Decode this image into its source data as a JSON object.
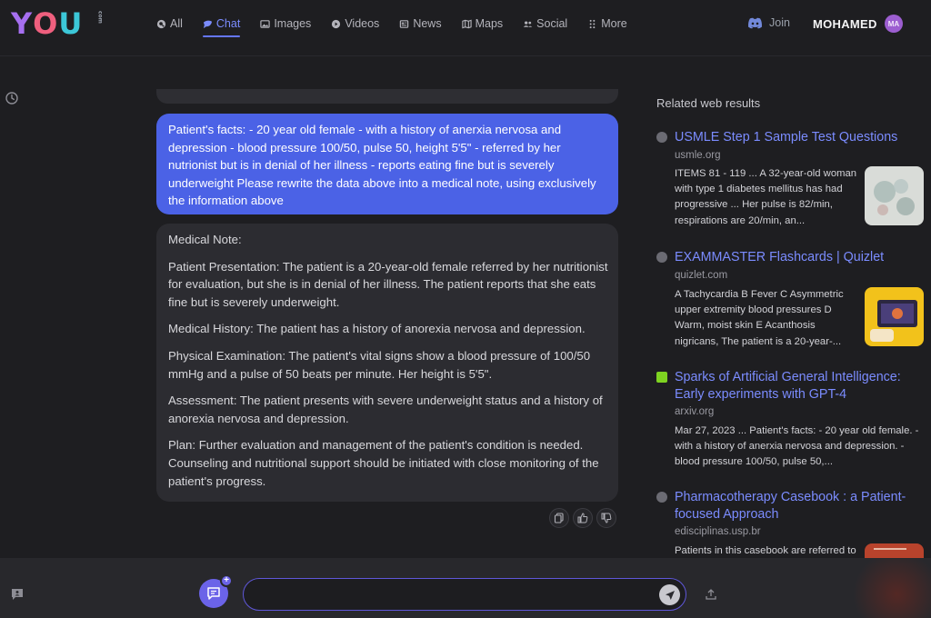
{
  "header": {
    "logo_letters": [
      "Y",
      "O",
      "U"
    ],
    "logo_suffix": "com",
    "tabs": [
      {
        "label": "All",
        "icon": "search-icon"
      },
      {
        "label": "Chat",
        "icon": "chat-icon",
        "active": true
      },
      {
        "label": "Images",
        "icon": "images-icon"
      },
      {
        "label": "Videos",
        "icon": "play-icon"
      },
      {
        "label": "News",
        "icon": "news-icon"
      },
      {
        "label": "Maps",
        "icon": "map-icon"
      },
      {
        "label": "Social",
        "icon": "people-icon"
      },
      {
        "label": "More",
        "icon": "dots-grid-icon"
      }
    ],
    "join_label": "Join",
    "username": "MOHAMED",
    "avatar_initials": "MA"
  },
  "chat": {
    "user_message": "Patient's facts: - 20 year old female - with a history of anerxia nervosa and depression - blood pressure 100/50, pulse 50, height 5'5\" - referred by her nutrionist but is in denial of her illness - reports eating fine but is severely underweight Please rewrite the data above into a medical note, using exclusively the information above",
    "bot_paragraphs": [
      "Medical Note:",
      "Patient Presentation: The patient is a 20-year-old female referred by her nutritionist for evaluation, but she is in denial of her illness. The patient reports that she eats fine but is severely underweight.",
      "Medical History: The patient has a history of anorexia nervosa and depression.",
      "Physical Examination: The patient's vital signs show a blood pressure of 100/50 mmHg and a pulse of 50 beats per minute. Her height is 5'5\".",
      "Assessment: The patient presents with severe underweight status and a history of anorexia nervosa and depression.",
      "Plan: Further evaluation and management of the patient's condition is needed. Counseling and nutritional support should be initiated with close monitoring of the patient's progress."
    ]
  },
  "related": {
    "title": "Related web results",
    "results": [
      {
        "title": "USMLE Step 1 Sample Test Questions",
        "domain": "usmle.org",
        "snippet": "ITEMS 81 - 119 ... A 32-year-old woman with type 1 diabetes mellitus has had progressive ... Her pulse is 82/min, respirations are 20/min, an..."
      },
      {
        "title": "EXAMMASTER Flashcards | Quizlet",
        "domain": "quizlet.com",
        "snippet": "A Tachycardia B Fever C Asymmetric upper extremity blood pressures D Warm, moist skin E Acanthosis nigricans, The patient is a 20-year-..."
      },
      {
        "title": "Sparks of Artificial General Intelligence: Early experiments with GPT-4",
        "domain": "arxiv.org",
        "snippet": "Mar 27, 2023 ... Patient's facts: - 20 year old female. - with a history of anerxia nervosa and depression. - blood pressure 100/50, pulse 50,..."
      },
      {
        "title": "Pharmacotherapy Casebook : a Patient-focused Approach",
        "domain": "edisciplinas.usp.br",
        "snippet": "Patients in this casebook are referred to"
      }
    ]
  },
  "input": {
    "value": "",
    "placeholder": ""
  },
  "colors": {
    "accent": "#4b62e6",
    "link": "#7b8cff",
    "background": "#1e1e21"
  }
}
